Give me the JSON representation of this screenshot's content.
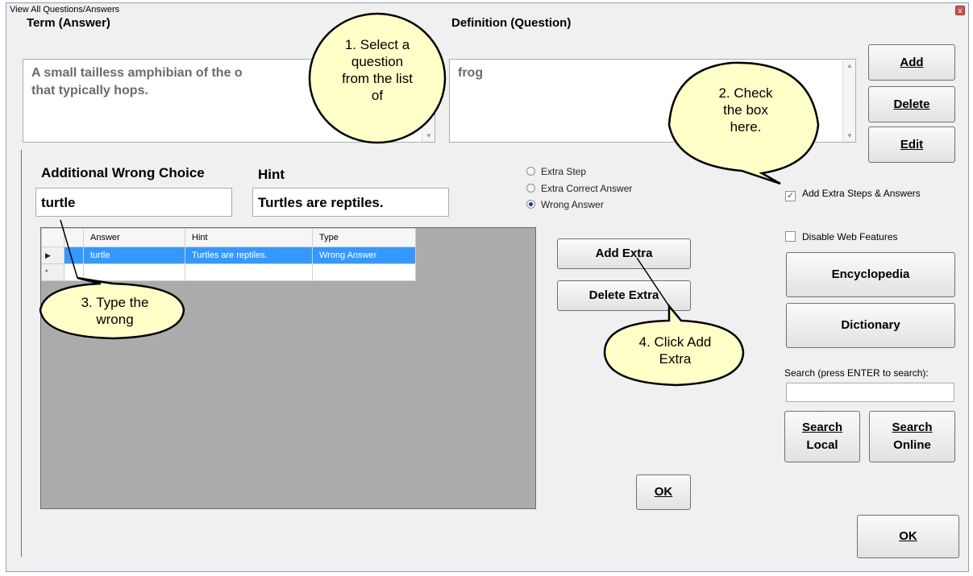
{
  "window": {
    "title": "View All Questions/Answers",
    "close_symbol": "x"
  },
  "term": {
    "label": "Term (Answer)",
    "value": "A small tailless amphibian of the o\nthat typically hops."
  },
  "definition": {
    "label": "Definition (Question)",
    "value": "frog"
  },
  "buttons": {
    "add": "Add",
    "delete": "Delete",
    "edit": "Edit",
    "encyclopedia": "Encyclopedia",
    "dictionary": "Dictionary",
    "search_local_1": "Search",
    "search_local_2": "Local",
    "search_online_1": "Search",
    "search_online_2": "Online",
    "ok_main": "OK",
    "add_extra": "Add Extra",
    "delete_extra": "Delete Extra",
    "ok_panel": "OK"
  },
  "checks": {
    "extra_steps": {
      "label": "Add Extra Steps & Answers",
      "checked": true
    },
    "disable_web": {
      "label": "Disable Web Features",
      "checked": false
    }
  },
  "search": {
    "label": "Search (press ENTER to search):",
    "value": ""
  },
  "extra": {
    "wrong_choice_label": "Additional Wrong Choice",
    "wrong_choice_value": "turtle",
    "hint_label": "Hint",
    "hint_value": "Turtles are reptiles.",
    "radios": [
      {
        "label": "Extra Step",
        "selected": false
      },
      {
        "label": "Extra Correct Answer",
        "selected": false
      },
      {
        "label": "Wrong Answer",
        "selected": true
      }
    ]
  },
  "grid": {
    "columns": [
      "Answer",
      "Hint",
      "Type"
    ],
    "rows": [
      {
        "marker": "▶",
        "cells": [
          "turtle",
          "Turtles are reptiles.",
          "Wrong Answer"
        ]
      },
      {
        "marker": "*",
        "cells": [
          "",
          "",
          ""
        ]
      }
    ]
  },
  "callouts": {
    "c1": "1. Select a\nquestion\nfrom the list\nof",
    "c2": "2. Check\nthe box\nhere.",
    "c3": "3. Type the\nwrong",
    "c4": "4. Click Add\nExtra"
  }
}
